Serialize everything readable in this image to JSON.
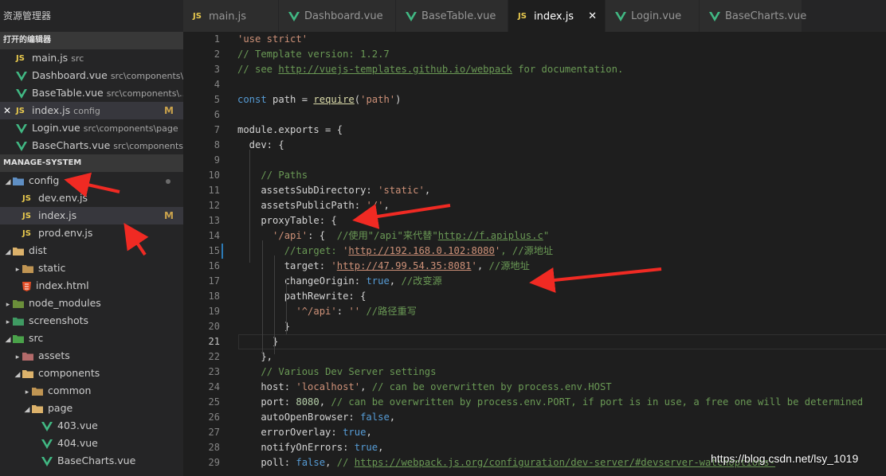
{
  "sidebar": {
    "title": "资源管理器",
    "open_editors": {
      "header": "打开的编辑器",
      "items": [
        {
          "icon": "js-icon",
          "name": "main.js",
          "desc": "src",
          "status": ""
        },
        {
          "icon": "vue-icon",
          "name": "Dashboard.vue",
          "desc": "src\\components\\...",
          "status": ""
        },
        {
          "icon": "vue-icon",
          "name": "BaseTable.vue",
          "desc": "src\\components\\...",
          "status": ""
        },
        {
          "icon": "js-icon",
          "name": "index.js",
          "desc": "config",
          "status": "M",
          "close": "✕"
        },
        {
          "icon": "vue-icon",
          "name": "Login.vue",
          "desc": "src\\components\\page",
          "status": ""
        },
        {
          "icon": "vue-icon",
          "name": "BaseCharts.vue",
          "desc": "src\\components\\...",
          "status": ""
        }
      ]
    },
    "project": {
      "header": "MANAGE-SYSTEM",
      "items": [
        {
          "twisty": "◢",
          "icon": "config-folder-icon",
          "name": "config",
          "status": "dot"
        },
        {
          "twisty": "",
          "icon": "js-icon",
          "name": "dev.env.js",
          "status": ""
        },
        {
          "twisty": "",
          "icon": "js-icon",
          "name": "index.js",
          "status": "M"
        },
        {
          "twisty": "",
          "icon": "js-icon",
          "name": "prod.env.js",
          "status": ""
        },
        {
          "twisty": "◢",
          "icon": "dist-folder-icon",
          "name": "dist",
          "status": ""
        },
        {
          "twisty": "▸",
          "icon": "folder-icon",
          "name": "static",
          "status": ""
        },
        {
          "twisty": "",
          "icon": "html-icon",
          "name": "index.html",
          "status": ""
        },
        {
          "twisty": "▸",
          "icon": "node-folder-icon",
          "name": "node_modules",
          "status": ""
        },
        {
          "twisty": "▸",
          "icon": "image-folder-icon",
          "name": "screenshots",
          "status": ""
        },
        {
          "twisty": "◢",
          "icon": "src-folder-icon",
          "name": "src",
          "status": ""
        },
        {
          "twisty": "▸",
          "icon": "assets-folder-icon",
          "name": "assets",
          "status": ""
        },
        {
          "twisty": "◢",
          "icon": "components-folder-icon",
          "name": "components",
          "status": ""
        },
        {
          "twisty": "▸",
          "icon": "folder-icon",
          "name": "common",
          "status": ""
        },
        {
          "twisty": "◢",
          "icon": "folder-open-icon",
          "name": "page",
          "status": ""
        },
        {
          "twisty": "",
          "icon": "vue-icon",
          "name": "403.vue",
          "status": ""
        },
        {
          "twisty": "",
          "icon": "vue-icon",
          "name": "404.vue",
          "status": ""
        },
        {
          "twisty": "",
          "icon": "vue-icon",
          "name": "BaseCharts.vue",
          "status": ""
        }
      ]
    }
  },
  "tabs": [
    {
      "icon": "js-icon",
      "label": "main.js"
    },
    {
      "icon": "vue-icon",
      "label": "Dashboard.vue"
    },
    {
      "icon": "vue-icon",
      "label": "BaseTable.vue"
    },
    {
      "icon": "js-icon",
      "label": "index.js",
      "close": "✕"
    },
    {
      "icon": "vue-icon",
      "label": "Login.vue"
    },
    {
      "icon": "vue-icon",
      "label": "BaseCharts.vue"
    }
  ],
  "editor": {
    "line_numbers": [
      "1",
      "2",
      "3",
      "4",
      "5",
      "6",
      "7",
      "8",
      "9",
      "10",
      "11",
      "12",
      "13",
      "14",
      "15",
      "16",
      "17",
      "18",
      "19",
      "20",
      "21",
      "22",
      "23",
      "24",
      "25",
      "26",
      "27",
      "28",
      "29"
    ],
    "lines": [
      [
        [
          "s",
          "'use strict'"
        ]
      ],
      [
        [
          "c",
          "// Template version: 1.2.7"
        ]
      ],
      [
        [
          "c",
          "// see "
        ],
        [
          "cu",
          "http://vuejs-templates.github.io/webpack"
        ],
        [
          "c",
          " for documentation."
        ]
      ],
      [],
      [
        [
          "k",
          "const"
        ],
        [
          "t",
          " path = "
        ],
        [
          "fu",
          "require"
        ],
        [
          "t",
          "("
        ],
        [
          "s",
          "'path'"
        ],
        [
          "t",
          ")"
        ]
      ],
      [],
      [
        [
          "t",
          "module.exports = {"
        ]
      ],
      [
        [
          "t",
          "  dev: {"
        ]
      ],
      [],
      [
        [
          "t",
          "    "
        ],
        [
          "c",
          "// Paths"
        ]
      ],
      [
        [
          "t",
          "    assetsSubDirectory: "
        ],
        [
          "s",
          "'static'"
        ],
        [
          "t",
          ","
        ]
      ],
      [
        [
          "t",
          "    assetsPublicPath: "
        ],
        [
          "s",
          "'/'"
        ],
        [
          "t",
          ","
        ]
      ],
      [
        [
          "t",
          "    proxyTable: {"
        ]
      ],
      [
        [
          "t",
          "      "
        ],
        [
          "s",
          "'/api'"
        ],
        [
          "t",
          ": {  "
        ],
        [
          "c",
          "//使用\"/api\"来代替\""
        ],
        [
          "cu",
          "http://f.apiplus.c"
        ],
        [
          "c",
          "\""
        ]
      ],
      [
        [
          "t",
          "        "
        ],
        [
          "c",
          "//target: "
        ],
        [
          "s",
          "'"
        ],
        [
          "su",
          "http://192.168.0.102:8080"
        ],
        [
          "s",
          "'"
        ],
        [
          "c",
          ", //源地址"
        ]
      ],
      [
        [
          "t",
          "        target: "
        ],
        [
          "s",
          "'"
        ],
        [
          "su",
          "http://47.99.54.35:8081"
        ],
        [
          "s",
          "'"
        ],
        [
          "t",
          ", "
        ],
        [
          "c",
          "//源地址"
        ]
      ],
      [
        [
          "t",
          "        changeOrigin: "
        ],
        [
          "k",
          "true"
        ],
        [
          "t",
          ", "
        ],
        [
          "c",
          "//改变源"
        ]
      ],
      [
        [
          "t",
          "        pathRewrite: {"
        ]
      ],
      [
        [
          "t",
          "          "
        ],
        [
          "s",
          "'^/api'"
        ],
        [
          "t",
          ": "
        ],
        [
          "s",
          "''"
        ],
        [
          "t",
          " "
        ],
        [
          "c",
          "//路径重写"
        ]
      ],
      [
        [
          "t",
          "        }"
        ]
      ],
      [
        [
          "t",
          "      }"
        ]
      ],
      [
        [
          "t",
          "    },"
        ]
      ],
      [
        [
          "t",
          "    "
        ],
        [
          "c",
          "// Various Dev Server settings"
        ]
      ],
      [
        [
          "t",
          "    host: "
        ],
        [
          "s",
          "'localhost'"
        ],
        [
          "t",
          ", "
        ],
        [
          "c",
          "// can be overwritten by process.env.HOST"
        ]
      ],
      [
        [
          "t",
          "    port: "
        ],
        [
          "n",
          "8080"
        ],
        [
          "t",
          ", "
        ],
        [
          "c",
          "// can be overwritten by process.env.PORT, if port is in use, a free one will be determined"
        ]
      ],
      [
        [
          "t",
          "    autoOpenBrowser: "
        ],
        [
          "k",
          "false"
        ],
        [
          "t",
          ","
        ]
      ],
      [
        [
          "t",
          "    errorOverlay: "
        ],
        [
          "k",
          "true"
        ],
        [
          "t",
          ","
        ]
      ],
      [
        [
          "t",
          "    notifyOnErrors: "
        ],
        [
          "k",
          "true"
        ],
        [
          "t",
          ","
        ]
      ],
      [
        [
          "t",
          "    poll: "
        ],
        [
          "k",
          "false"
        ],
        [
          "t",
          ", "
        ],
        [
          "c",
          "// "
        ],
        [
          "cu",
          "https://webpack.js.org/configuration/dev-server/#devserver-watchoptions-"
        ]
      ]
    ]
  },
  "watermark": "https://blog.csdn.net/lsy_1019",
  "colors": {
    "arrow": "#f02a23",
    "js": "#e8c94e",
    "vue": "#41b883",
    "modified": "#c9a24c"
  }
}
